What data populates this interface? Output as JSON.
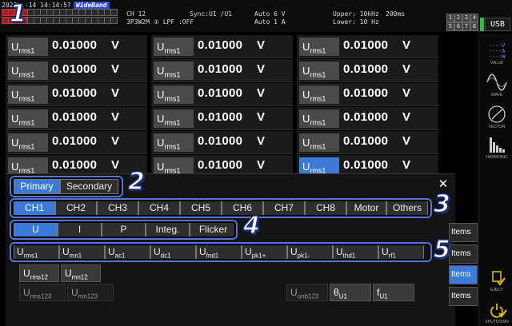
{
  "status": {
    "datetime": "2023-  -14 14:14:57",
    "wideband": "WideBand",
    "channel": "CH 12",
    "wiring": "3P3W2M ① LPF :OFF",
    "sync": "Sync:U1  /U1",
    "auto1": "Auto   6 V",
    "auto2": "Auto   1 A",
    "upper": "Upper: 10kHz",
    "lower": "Lower: 10 Hz",
    "interval": "200ms",
    "usb": "USB",
    "ch_top": [
      "1",
      "2",
      "3",
      "4"
    ],
    "ch_bottom": [
      "5",
      "6",
      "7",
      "8"
    ]
  },
  "grid": {
    "label_main": "U",
    "label_sub": "rms1",
    "cells": [
      [
        "0.01000",
        "V",
        "0.01000",
        "V",
        "0.01000",
        "V"
      ],
      [
        "0.01000",
        "V",
        "0.01000",
        "V",
        "0.01000",
        "V"
      ],
      [
        "0.01000",
        "V",
        "0.01000",
        "V",
        "0.01000",
        "V"
      ],
      [
        "0.01000",
        "V",
        "0.01000",
        "V",
        "0.01000",
        "V"
      ],
      [
        "0.01000",
        "V",
        "0.01000",
        "V",
        "0.01000",
        "V"
      ],
      [
        "0.01000",
        "V",
        "0.01000",
        "V",
        "0.01000",
        "V"
      ]
    ]
  },
  "sidebar": {
    "value": "VALUE",
    "wave": "WAVE",
    "vector": "VECTOR",
    "harmonic": "HARMONIC",
    "eject": "EJECT",
    "shutdown": "SHUTDOWN"
  },
  "dialog": {
    "close": "✕",
    "primary": "Primary",
    "secondary": "Secondary",
    "channels": [
      "CH1",
      "CH2",
      "CH3",
      "CH4",
      "CH5",
      "CH6",
      "CH7",
      "CH8",
      "Motor",
      "Others"
    ],
    "types": [
      "U",
      "I",
      "P",
      "Integ.",
      "Flicker"
    ],
    "params": [
      {
        "m": "U",
        "s": "rms1"
      },
      {
        "m": "U",
        "s": "mn1"
      },
      {
        "m": "U",
        "s": "ac1"
      },
      {
        "m": "U",
        "s": "dc1"
      },
      {
        "m": "U",
        "s": "fnd1"
      },
      {
        "m": "U",
        "s": "pk1+"
      },
      {
        "m": "U",
        "s": "pk1-"
      },
      {
        "m": "U",
        "s": "thd1"
      },
      {
        "m": "U",
        "s": "rf1"
      }
    ],
    "row2": [
      {
        "m": "U",
        "s": "rms12"
      },
      {
        "m": "U",
        "s": "mn12"
      }
    ],
    "row3": [
      {
        "m": "U",
        "s": "rms123"
      },
      {
        "m": "U",
        "s": "mn123"
      },
      {
        "m": "U",
        "s": "unb123"
      },
      {
        "m": "θ",
        "s": "U1"
      },
      {
        "m": "f",
        "s": "U1"
      }
    ],
    "items": [
      "Items",
      "Items",
      "Items",
      "Items"
    ]
  },
  "callouts": [
    "1",
    "2",
    "3",
    "4",
    "5"
  ]
}
